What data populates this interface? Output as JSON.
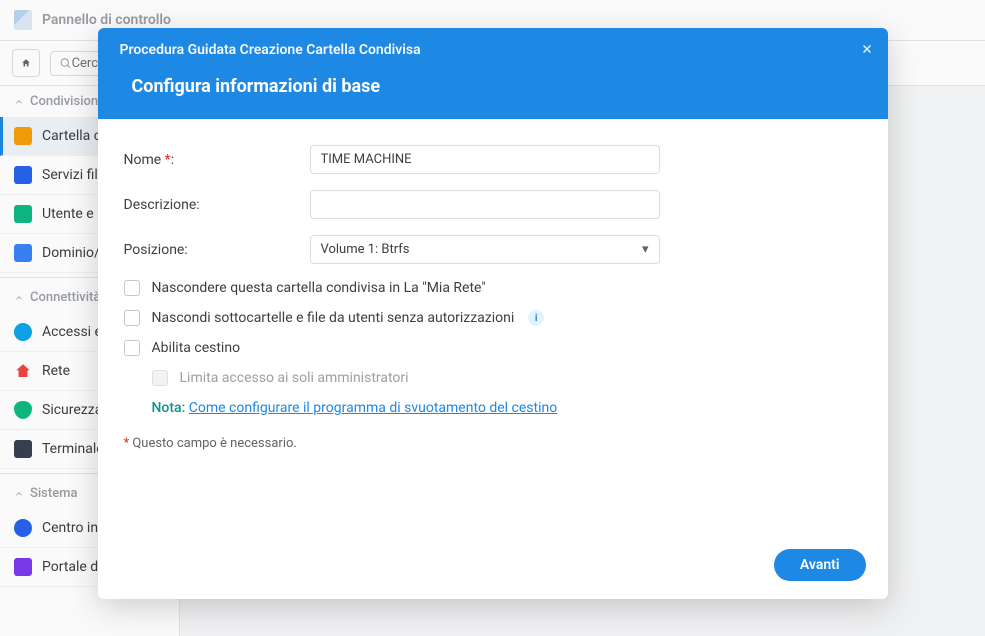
{
  "window": {
    "title": "Pannello di controllo"
  },
  "search": {
    "placeholder": "Cerca"
  },
  "sidebar": {
    "sections": {
      "fileshare": "Condivisione file",
      "connectivity": "Connettività",
      "system": "Sistema"
    },
    "items": {
      "sharedFolder": "Cartella condivisa",
      "fileServices": "Servizi file",
      "userGroup": "Utente e Gruppo",
      "domain": "Dominio/LDAP",
      "externalAccess": "Accessi esterni",
      "network": "Rete",
      "security": "Sicurezza",
      "terminal": "Terminale e SNMP",
      "infoCenter": "Centro informazioni",
      "portal": "Portale di accesso"
    }
  },
  "modal": {
    "wizardTitle": "Procedura Guidata Creazione Cartella Condivisa",
    "heading": "Configura informazioni di base",
    "labels": {
      "name": "Nome",
      "description": "Descrizione:",
      "location": "Posizione:"
    },
    "values": {
      "name": "TIME MACHINE",
      "description": "",
      "location": "Volume 1:  Btrfs"
    },
    "checks": {
      "hideNetwork": "Nascondere questa cartella condivisa in La \"Mia Rete\"",
      "hideSubfolders": "Nascondi sottocartelle e file da utenti senza autorizzazioni",
      "enableBin": "Abilita cestino",
      "restrictAdmins": "Limita accesso ai soli amministratori"
    },
    "note": {
      "label": "Nota:",
      "link": "Come configurare il programma di svuotamento del cestino"
    },
    "requiredHint": "Questo campo è necessario.",
    "nextBtn": "Avanti"
  }
}
